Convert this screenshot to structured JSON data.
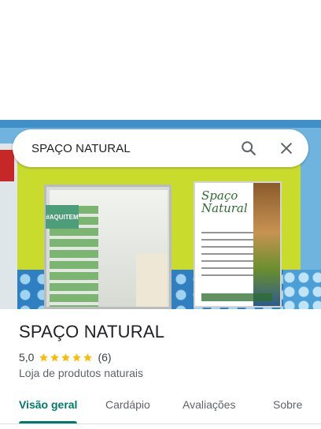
{
  "search": {
    "query": "SPAÇO NATURAL",
    "search_icon": "search-icon",
    "close_icon": "close-icon"
  },
  "hero": {
    "photo_subject": "storefront",
    "sign_brand": "Spaço\nNatural",
    "door_sign": "#AQUITEM"
  },
  "place": {
    "name": "SPAÇO NATURAL",
    "rating": "5,0",
    "stars": 5,
    "review_count": "(6)",
    "category": "Loja de produtos naturais"
  },
  "tabs": [
    {
      "label": "Visão geral",
      "active": true
    },
    {
      "label": "Cardápio",
      "active": false
    },
    {
      "label": "Avaliações",
      "active": false
    },
    {
      "label": "Sobre",
      "active": false
    }
  ],
  "colors": {
    "accent": "#00796b",
    "star": "#fbbc04",
    "text_primary": "#202124",
    "text_secondary": "#5f6368"
  }
}
